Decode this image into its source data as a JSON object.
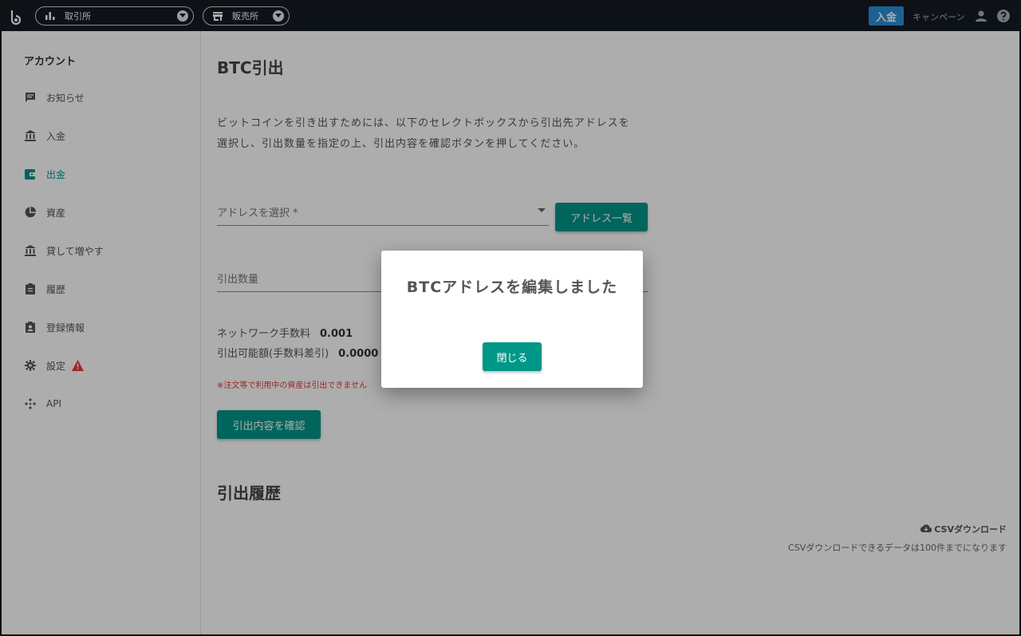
{
  "header": {
    "exchange_label": "取引所",
    "store_label": "販売所",
    "deposit_label": "入金",
    "campaign_label": "キャンペーン"
  },
  "sidebar": {
    "title": "アカウント",
    "items": [
      {
        "label": "お知らせ",
        "icon": "message-icon"
      },
      {
        "label": "入金",
        "icon": "bank-icon"
      },
      {
        "label": "出金",
        "icon": "wallet-icon",
        "active": true
      },
      {
        "label": "資産",
        "icon": "pie-chart-icon"
      },
      {
        "label": "貸して増やす",
        "icon": "bank-icon"
      },
      {
        "label": "履歴",
        "icon": "clipboard-icon"
      },
      {
        "label": "登録情報",
        "icon": "account-box-icon"
      },
      {
        "label": "設定",
        "icon": "gear-icon"
      },
      {
        "label": "API",
        "icon": "api-icon"
      }
    ]
  },
  "main": {
    "title": "BTC引出",
    "description_line1": "ビットコインを引き出すためには、以下のセレクトボックスから引出先アドレスを",
    "description_line2": "選択し、引出数量を指定の上、引出内容を確認ボタンを押してください。",
    "address_select_label": "アドレスを選択 *",
    "address_list_button": "アドレス一覧",
    "amount_label": "引出数量",
    "fee_label": "ネットワーク手数料",
    "fee_value": "0.001",
    "available_label": "引出可能額(手数料差引)",
    "available_value": "0.0000",
    "note": "※注文等で利用中の資産は引出できません",
    "confirm_button": "引出内容を確認",
    "history_title": "引出履歴",
    "csv_link": "CSVダウンロード",
    "csv_note": "CSVダウンロードできるデータは100件までになります"
  },
  "dialog": {
    "title": "BTCアドレスを編集しました",
    "close_button": "閉じる"
  },
  "colors": {
    "accent": "#009688",
    "topbar": "#141a24",
    "deposit": "#2a8fd6",
    "warning": "#e53935"
  }
}
